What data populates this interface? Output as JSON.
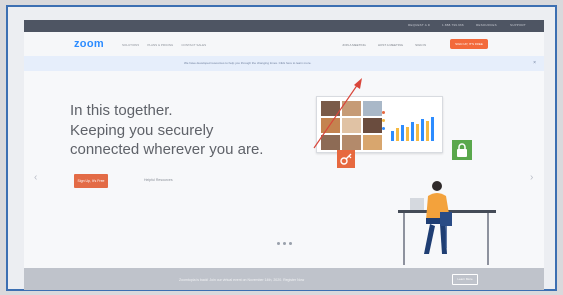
{
  "topbar": {
    "links": [
      "REQUEST A DEMO",
      "1.888.799.9666",
      "RESOURCES",
      "SUPPORT"
    ]
  },
  "nav": {
    "logo": "zoom",
    "left_links": [
      "SOLUTIONS",
      "PLANS & PRICING",
      "CONTACT SALES"
    ],
    "right_links": [
      "JOIN A MEETING",
      "HOST A MEETING",
      "SIGN IN"
    ],
    "signup_label": "SIGN UP, IT'S FREE"
  },
  "banner": {
    "text": "We have developed resources to help you through the changing times. Click here to learn more.",
    "close": "×"
  },
  "hero": {
    "title": "In this together.\nKeeping you securely\nconnected wherever you are.",
    "cta_label": "Sign Up, It's Free",
    "cta_link": "Helpful Resources"
  },
  "carousel": {
    "prev": "‹",
    "next": "›",
    "dot_count": 3
  },
  "bottom_bar": {
    "text": "Zoomtopia is back! Join our virtual event on November 14th, 2020. Register Now",
    "button_label": "Learn More"
  },
  "colors": {
    "accent": "#2d8cff",
    "cta": "#e36b46",
    "annotation_arrow": "#d9463b",
    "frame_border": "#3c6fb2"
  }
}
